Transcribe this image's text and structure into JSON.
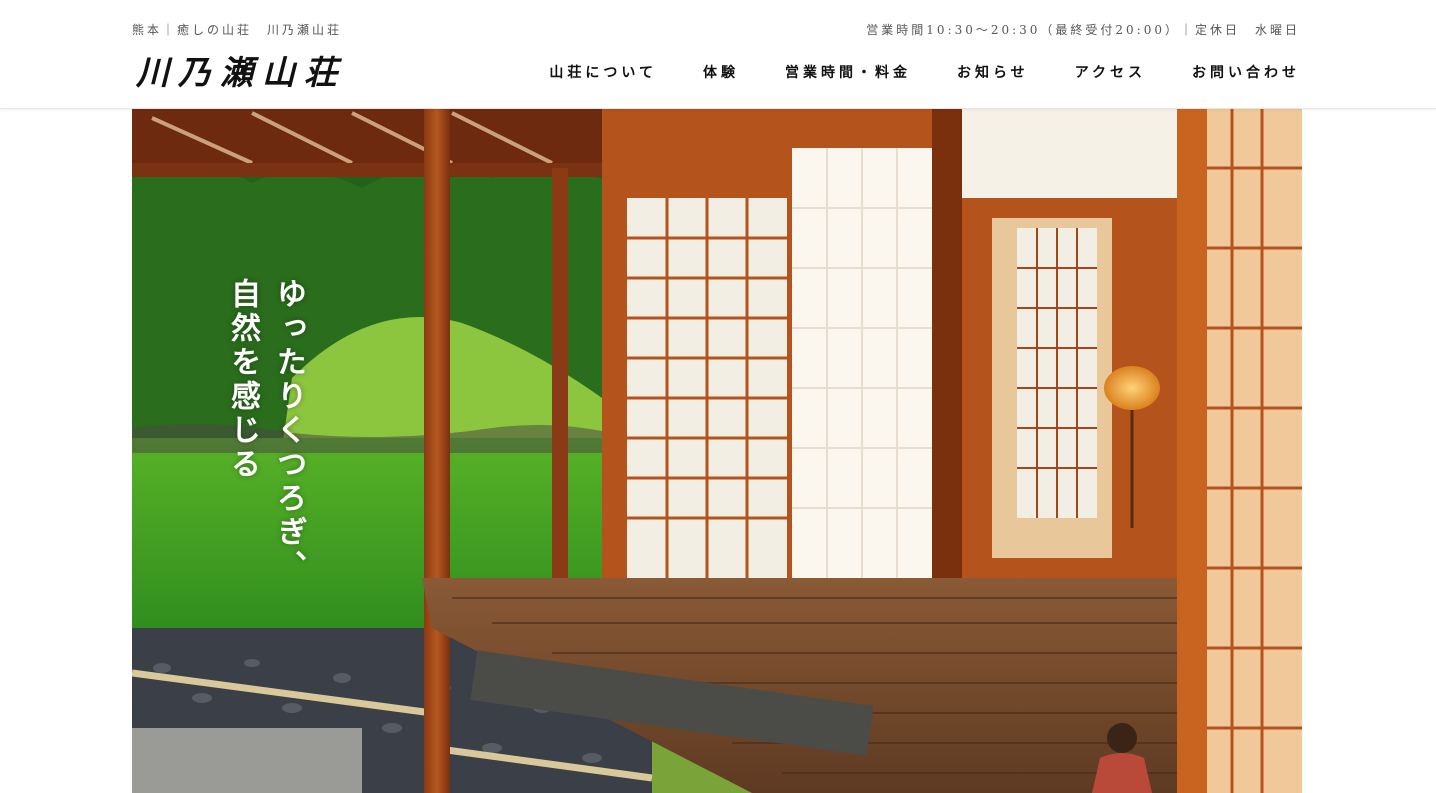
{
  "header": {
    "tagline": "熊本｜癒しの山荘　川乃瀬山荘",
    "hours": "営業時間10:30〜20:30（最終受付20:00）｜定休日　水曜日",
    "logo_text": "川乃瀬山荘"
  },
  "nav": {
    "items": [
      {
        "label": "山荘について"
      },
      {
        "label": "体験"
      },
      {
        "label": "営業時間・料金"
      },
      {
        "label": "お知らせ"
      },
      {
        "label": "アクセス"
      },
      {
        "label": "お問い合わせ"
      }
    ]
  },
  "hero": {
    "line1": "ゆったりくつろぎ、",
    "line2": "自然を感じる"
  }
}
